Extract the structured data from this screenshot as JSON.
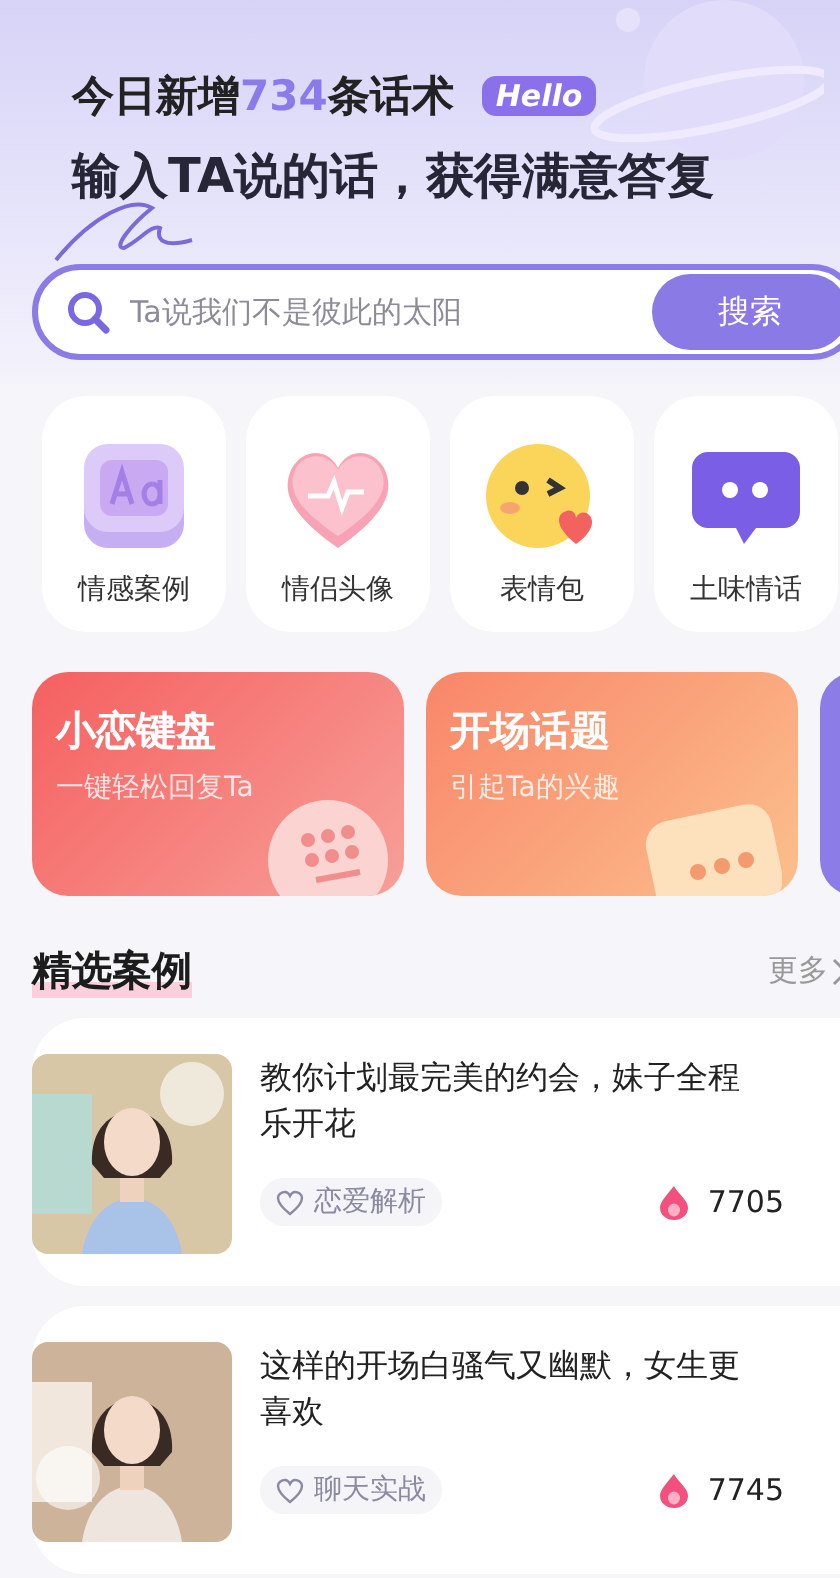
{
  "header": {
    "line1_before": "今日新增",
    "line1_count": "734",
    "line1_after": "条话术",
    "badge": "Hello",
    "headline": "输入TA说的话，获得满意答复"
  },
  "search": {
    "placeholder": "Ta说我们不是彼此的太阳",
    "button": "搜索"
  },
  "categories": [
    {
      "kind": "font",
      "label": "情感案例"
    },
    {
      "kind": "heart",
      "label": "情侣头像"
    },
    {
      "kind": "emoji",
      "label": "表情包"
    },
    {
      "kind": "chat",
      "label": "土味情话"
    }
  ],
  "banners": [
    {
      "kind": "keyboard",
      "title": "小恋键盘",
      "subtitle": "一键轻松回复Ta"
    },
    {
      "kind": "topic",
      "title": "开场话题",
      "subtitle": "引起Ta的兴趣"
    },
    {
      "kind": "clipped"
    }
  ],
  "section": {
    "title": "精选案例",
    "more": "更多"
  },
  "cases": [
    {
      "kind": "picture",
      "title": "教你计划最完美的约会，妹子全程乐开花",
      "tag": "恋爱解析",
      "count": "7705"
    },
    {
      "kind": "picture",
      "title": "这样的开场白骚气又幽默，女生更喜欢",
      "tag": "聊天实战",
      "count": "7745"
    }
  ]
}
